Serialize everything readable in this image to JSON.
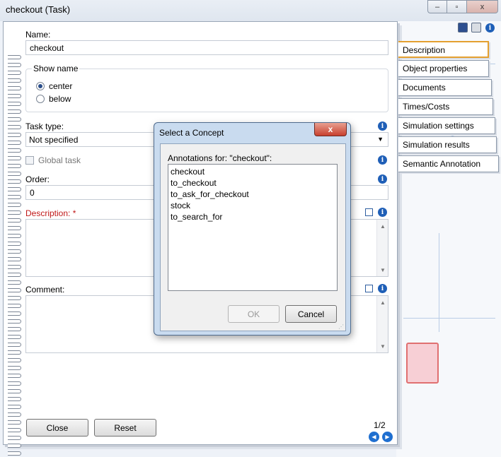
{
  "window": {
    "title": "checkout (Task)",
    "minimize": "–",
    "restore": "▫",
    "close": "x"
  },
  "form": {
    "name_label": "Name:",
    "name_value": "checkout",
    "show_name_label": "Show name",
    "radio_center": "center",
    "radio_below": "below",
    "task_type_label": "Task type:",
    "task_type_value": "Not specified",
    "global_task_label": "Global task",
    "order_label": "Order:",
    "order_value": "0",
    "description_label": "Description:",
    "description_required": "*",
    "comment_label": "Comment:",
    "close_button": "Close",
    "reset_button": "Reset",
    "page_indicator": "1/2"
  },
  "tabs": [
    {
      "label": "Description"
    },
    {
      "label": "Object properties"
    },
    {
      "label": "Documents"
    },
    {
      "label": "Times/Costs"
    },
    {
      "label": "Simulation settings"
    },
    {
      "label": "Simulation results"
    },
    {
      "label": "Semantic Annotation"
    }
  ],
  "dialog": {
    "title": "Select a Concept",
    "close": "x",
    "list_label": "Annotations for: \"checkout\":",
    "items": [
      "checkout",
      "to_checkout",
      "to_ask_for_checkout",
      "stock",
      "to_search_for"
    ],
    "ok_button": "OK",
    "cancel_button": "Cancel"
  },
  "colors": {
    "accent": "#1f5fb7",
    "required": "#c01818",
    "active_tab": "#e4a030"
  }
}
